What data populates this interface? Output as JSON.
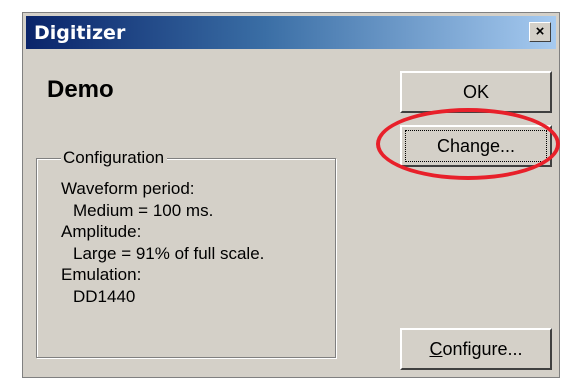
{
  "window": {
    "title": "Digitizer",
    "close_label": "×"
  },
  "app": {
    "name": "Demo"
  },
  "configuration": {
    "title": "Configuration",
    "lines": [
      "Waveform period:",
      "Medium = 100 ms.",
      "Amplitude:",
      "Large = 91% of full scale.",
      "Emulation:",
      "DD1440"
    ]
  },
  "buttons": {
    "ok": "OK",
    "change": "Change...",
    "configure_mnemonic": "C",
    "configure_rest": "onfigure..."
  },
  "annotation": {
    "highlight_color": "#e8202a"
  }
}
